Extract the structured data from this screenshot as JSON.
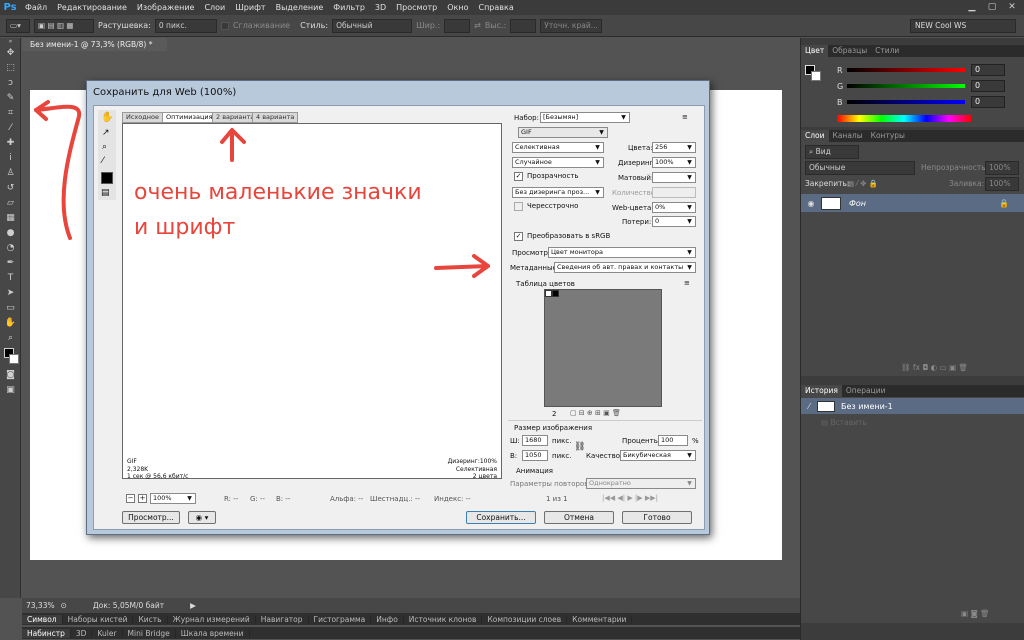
{
  "app": {
    "logo": "Ps"
  },
  "menu": [
    "Файл",
    "Редактирование",
    "Изображение",
    "Слои",
    "Шрифт",
    "Выделение",
    "Фильтр",
    "3D",
    "Просмотр",
    "Окно",
    "Справка"
  ],
  "options": {
    "feather_label": "Растушевка:",
    "feather_value": "0 пикс.",
    "antialias_label": "Сглаживание",
    "style_label": "Стиль:",
    "style_value": "Обычный",
    "width_label": "Шир.:",
    "height_label": "Выс.:",
    "refine_label": "Уточн. край...",
    "workspace": "NEW Cool WS"
  },
  "document_tab": "Без имени-1 @ 73,3% (RGB/8) *",
  "dialog": {
    "title": "Сохранить для Web (100%)",
    "tabs": [
      "Исходное",
      "Оптимизация",
      "2 варианта",
      "4 варианта"
    ],
    "preview_info": {
      "format": "GIF",
      "size": "2,328K",
      "time": "1 сек @ 56,6 кбит/с",
      "dither": "Дизеринг:100%",
      "palette": "Селективная",
      "colors": "2 цвета"
    },
    "bottom": {
      "zoom": "100%",
      "r": "R: --",
      "g": "G: --",
      "b": "B: --",
      "alpha": "Альфа: --",
      "hex": "Шестнадц.: --",
      "index": "Индекс: --"
    },
    "settings": {
      "preset_label": "Набор:",
      "preset_value": "[Безымян]",
      "format": "GIF",
      "reduction": "Селективная",
      "colors_label": "Цвета:",
      "colors_value": "256",
      "dither_method": "Случайное",
      "dither_label": "Дизеринг:",
      "dither_value": "100%",
      "transparency": "Прозрачность",
      "matte_label": "Матовый:",
      "transp_dither": "Без дизеринга проз...",
      "amount_label": "Количество:",
      "interlaced": "Чересстрочно",
      "websnap_label": "Web-цвета:",
      "websnap_value": "0%",
      "lossy_label": "Потери:",
      "lossy_value": "0",
      "convert_srgb": "Преобразовать в sRGB",
      "preview_label": "Просмотр:",
      "preview_value": "Цвет монитора",
      "metadata_label": "Метаданные:",
      "metadata_value": "Сведения об авт. правах и контакты",
      "color_table_label": "Таблица цветов",
      "color_count": "2",
      "image_size_label": "Размер изображения",
      "w_label": "Ш:",
      "w_value": "1680",
      "h_label": "В:",
      "h_value": "1050",
      "px": "пикс.",
      "percent_label": "Проценты:",
      "percent_value": "100",
      "percent_sign": "%",
      "quality_label": "Качество:",
      "quality_value": "Бикубическая",
      "animation_label": "Анимация",
      "loop_label": "Параметры повторов:",
      "loop_value": "Однократно",
      "frames": "1 из 1"
    },
    "buttons": {
      "preview": "Просмотр...",
      "save": "Сохранить...",
      "cancel": "Отмена",
      "done": "Готово"
    }
  },
  "annotation": {
    "line1": "очень маленькие значки",
    "line2": "и шрифт"
  },
  "panels": {
    "color_tabs": [
      "Цвет",
      "Образцы",
      "Стили"
    ],
    "r_label": "R",
    "g_label": "G",
    "b_label": "B",
    "r_value": "0",
    "g_value": "0",
    "b_value": "0",
    "layers_tabs": [
      "Слои",
      "Каналы",
      "Контуры"
    ],
    "kind_label": "Вид",
    "blend_mode": "Обычные",
    "opacity_label": "Непрозрачность:",
    "opacity_value": "100%",
    "lock_label": "Закрепить:",
    "fill_label": "Заливка:",
    "fill_value": "100%",
    "layer_name": "Фон",
    "history_tabs": [
      "История",
      "Операции"
    ],
    "history_item": "Без имени-1",
    "history_action": "Вставить"
  },
  "status": {
    "zoom": "73,33%",
    "doc": "Док: 5,05M/0 байт"
  },
  "bottom_tabs_1": [
    "Символ",
    "Наборы кистей",
    "Кисть",
    "Журнал измерений",
    "Навигатор",
    "Гистограмма",
    "Инфо",
    "Источник клонов",
    "Композиции слоев",
    "Комментарии"
  ],
  "bottom_tabs_2": [
    "Набинстр",
    "3D",
    "Kuler",
    "Mini Bridge",
    "Шкала времени"
  ],
  "colors": {
    "accent_red": "#e8453c",
    "ps_blue": "#31a8ff",
    "layer_selected": "#5b6b84"
  }
}
